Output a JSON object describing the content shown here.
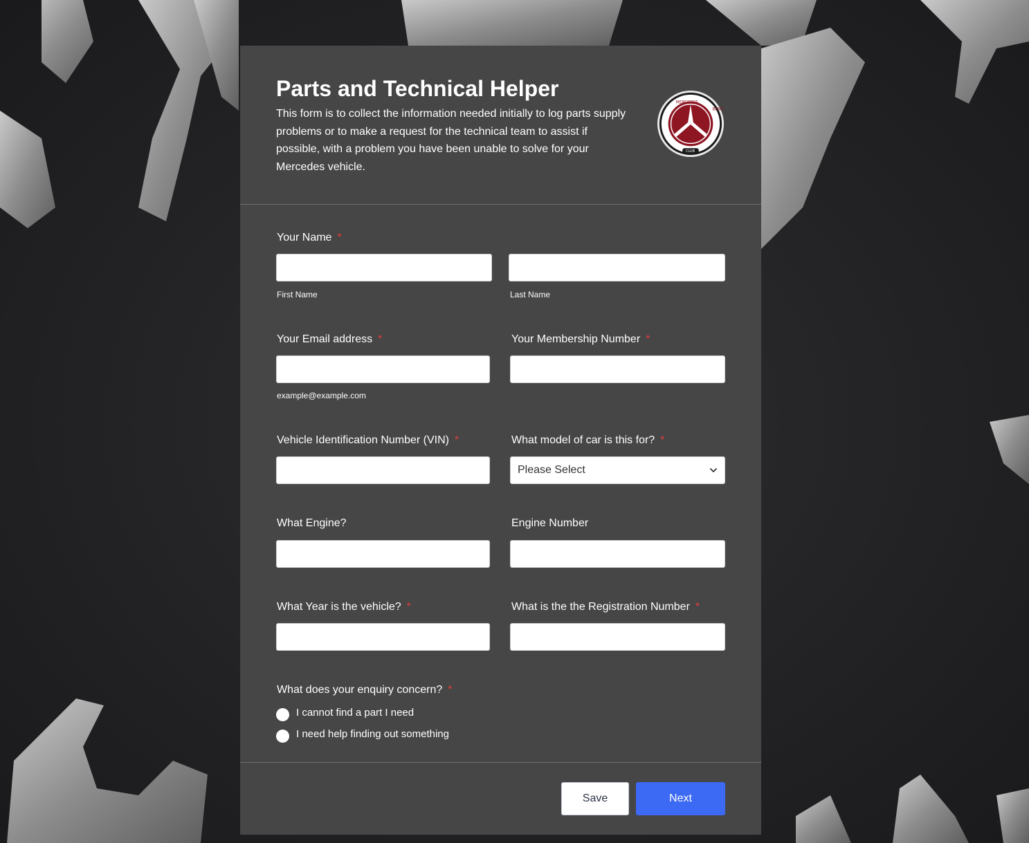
{
  "form": {
    "title": "Parts and Technical Helper",
    "description": "This form is to collect the information needed initially to log parts supply problems or to make a request for the technical team to assist if possible, with a problem you have been unable to solve for your Mercedes vehicle.",
    "logo_text_top": "MERCEDES",
    "logo_text_right": "BENZ",
    "logo_text_bottom": "CLUB"
  },
  "fields": {
    "name": {
      "label": "Your Name",
      "required": "*",
      "first_sub": "First Name",
      "last_sub": "Last Name"
    },
    "email": {
      "label": "Your Email address",
      "required": "*",
      "sub": "example@example.com"
    },
    "membership": {
      "label": "Your Membership Number",
      "required": "*"
    },
    "vin": {
      "label": "Vehicle Identification Number (VIN)",
      "required": "*"
    },
    "model": {
      "label": "What model of car is this for?",
      "required": "*",
      "selected": "Please Select"
    },
    "engine": {
      "label": "What Engine?"
    },
    "engine_number": {
      "label": "Engine Number"
    },
    "year": {
      "label": "What Year is the vehicle?",
      "required": "*"
    },
    "registration": {
      "label": "What is the the Registration Number",
      "required": "*"
    },
    "enquiry": {
      "label": "What does your enquiry concern?",
      "required": "*",
      "options": [
        "I cannot find a part I need",
        "I need help finding out something"
      ]
    }
  },
  "buttons": {
    "save": "Save",
    "next": "Next"
  },
  "colors": {
    "card": "#464646",
    "accent": "#3c6af4",
    "required": "#e23b3b",
    "logo_red": "#8e1522"
  }
}
